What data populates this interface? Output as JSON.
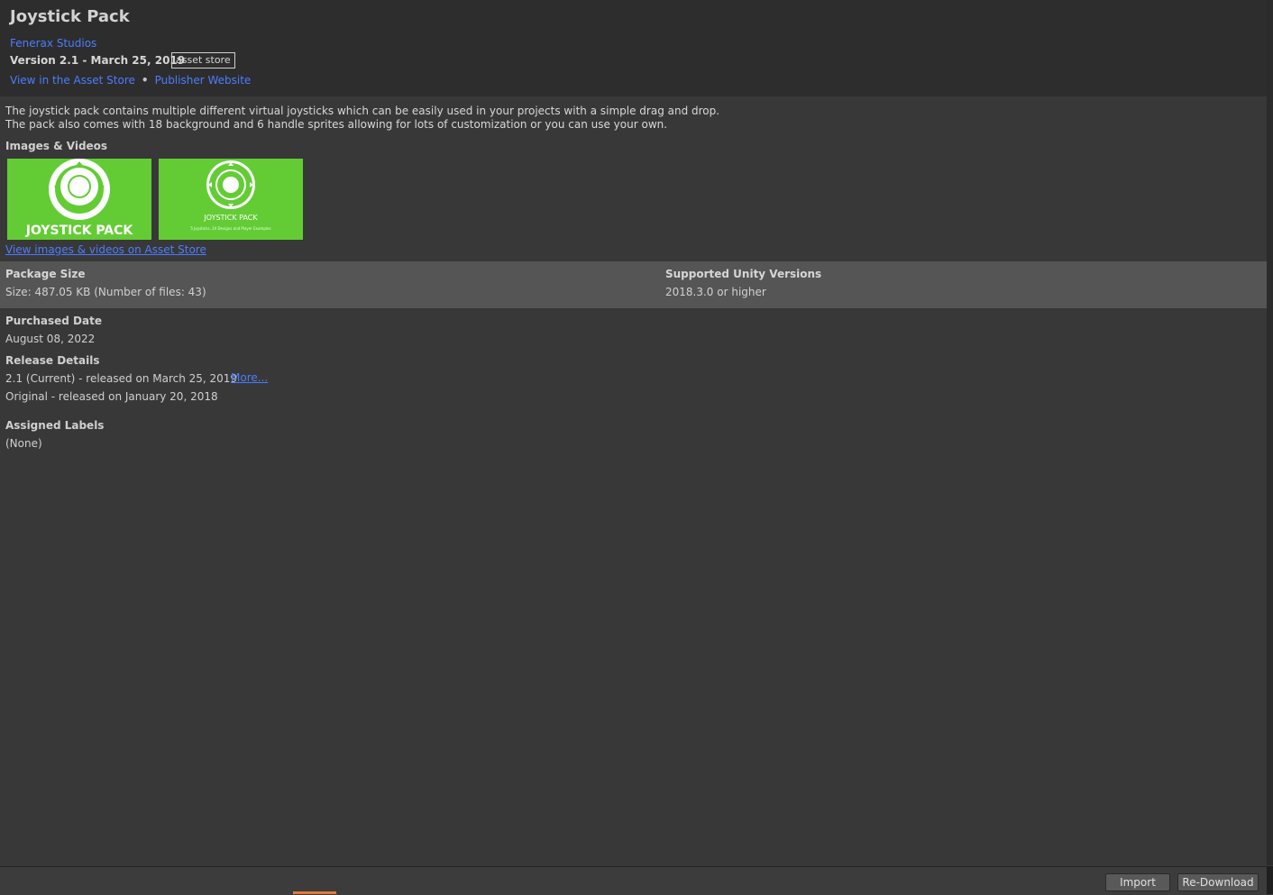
{
  "header": {
    "title": "Joystick Pack",
    "publisher": "Fenerax Studios",
    "version": "Version 2.1 - March 25, 2019",
    "badge": "asset store",
    "view_link": "View in the Asset Store",
    "separator": "•",
    "publisher_link": "Publisher Website"
  },
  "description": {
    "line1": "The joystick pack contains multiple different virtual joysticks which can be easily used in your projects with a simple drag and drop.",
    "line2": "The pack also comes with 18 background and 6 handle sprites allowing for lots of customization or you can use your own."
  },
  "media": {
    "section_title": "Images & Videos",
    "thumb1_text": "JOYSTICK PACK",
    "thumb2_text": "JOYSTICK PACK",
    "thumb2_subtext": "5 Joysticks, 24 Designs and Player Examples",
    "link": "View images & videos on Asset Store"
  },
  "package": {
    "size_label": "Package Size",
    "size_value": "Size: 487.05 KB (Number of files: 43)",
    "unity_label": "Supported Unity Versions",
    "unity_value": "2018.3.0 or higher"
  },
  "purchase": {
    "label": "Purchased Date",
    "value": "August 08, 2022"
  },
  "release": {
    "label": "Release Details",
    "current": "2.1 (Current) - released on March 25, 2019",
    "more_link": "More...",
    "original": "Original - released on January 20, 2018"
  },
  "labels": {
    "label": "Assigned Labels",
    "value": "(None)"
  },
  "footer": {
    "import_button": "Import",
    "redownload_button": "Re-Download"
  },
  "colors": {
    "background": "#383838",
    "header_background": "#2d2d2d",
    "link": "#4c7dff",
    "thumbnail_green": "#63cc35",
    "band": "#555555"
  }
}
